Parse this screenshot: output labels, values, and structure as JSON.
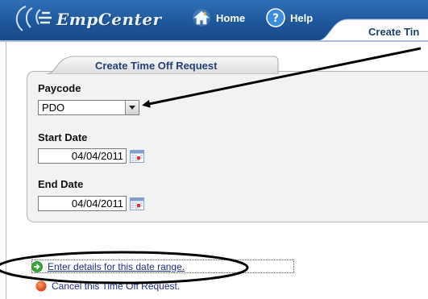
{
  "header": {
    "logo_text": "EmpCenter",
    "nav": [
      {
        "label": "Home",
        "icon": "home-icon"
      },
      {
        "label": "Help",
        "icon": "help-icon"
      }
    ],
    "tab_label": "Create Tin"
  },
  "form": {
    "title": "Create Time Off Request",
    "paycode": {
      "label": "Paycode",
      "value": "PDO"
    },
    "start_date": {
      "label": "Start Date",
      "value": "04/04/2011"
    },
    "end_date": {
      "label": "End Date",
      "value": "04/04/2011"
    }
  },
  "actions": {
    "enter_details": "Enter details for this date range.",
    "cancel": "Cancel this Time Off Request."
  },
  "colors": {
    "header_blue": "#1f579c",
    "link_blue": "#1f2f8c",
    "go_green": "#3aa63a",
    "cancel_red": "#e24c1a"
  }
}
